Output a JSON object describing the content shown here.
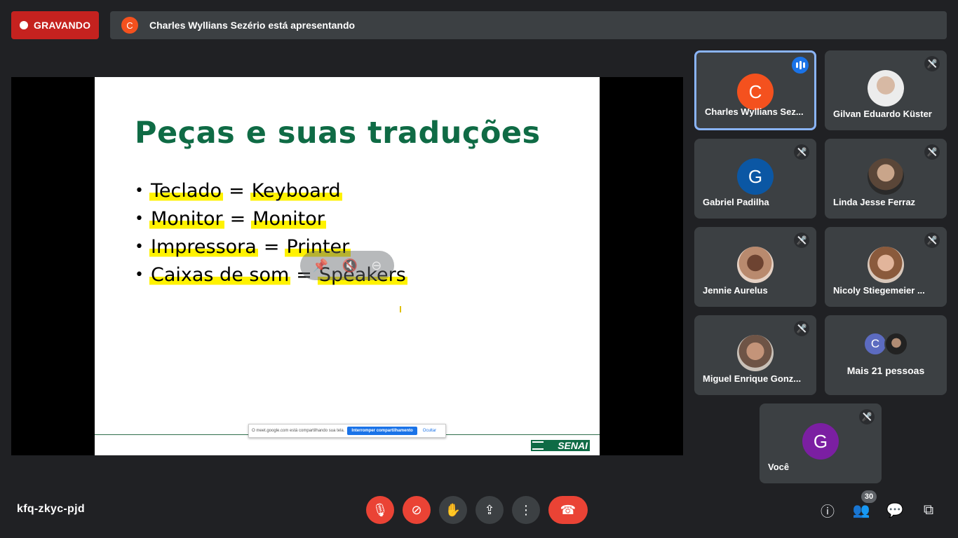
{
  "recording": {
    "label": "GRAVANDO"
  },
  "presenting": {
    "avatar_letter": "C",
    "text": "Charles Wyllians Sezério está apresentando"
  },
  "slide": {
    "title": "Peças e suas traduções",
    "items": [
      {
        "term": "Teclado",
        "translation": "Keyboard"
      },
      {
        "term": "Monitor",
        "translation": "Monitor"
      },
      {
        "term": "Impressora",
        "translation": "Printer"
      },
      {
        "term": "Caixas de som",
        "translation": "Speakers"
      }
    ],
    "logo_text": "SENAI",
    "share_bar": {
      "message": "O meet.google.com está compartilhando sua tela.",
      "stop_label": "Interromper compartilhamento",
      "hide_label": "Ocultar"
    }
  },
  "participants": [
    {
      "name": "Charles Wyllians Sez...",
      "avatar": "C",
      "avatar_color": "#f4511e",
      "speaking": true
    },
    {
      "name": "Gilvan Eduardo Küster",
      "photo": true,
      "muted": true
    },
    {
      "name": "Gabriel Padilha",
      "avatar": "G",
      "avatar_color": "#0b57a4",
      "muted": true
    },
    {
      "name": "Linda Jesse Ferraz",
      "photo": true,
      "muted": true
    },
    {
      "name": "Jennie Aurelus",
      "photo": true,
      "muted": true
    },
    {
      "name": "Nicoly Stiegemeier ...",
      "photo": true,
      "muted": true
    },
    {
      "name": "Miguel Enrique Gonz...",
      "photo": true,
      "muted": true
    },
    {
      "name": "Você",
      "avatar": "G",
      "avatar_color": "#7b1fa2",
      "muted": true
    }
  ],
  "more_people": {
    "avatar_letter": "C",
    "label": "Mais 21 pessoas"
  },
  "bottom": {
    "meeting_code": "kfq-zkyc-pjd",
    "people_count": "30"
  }
}
